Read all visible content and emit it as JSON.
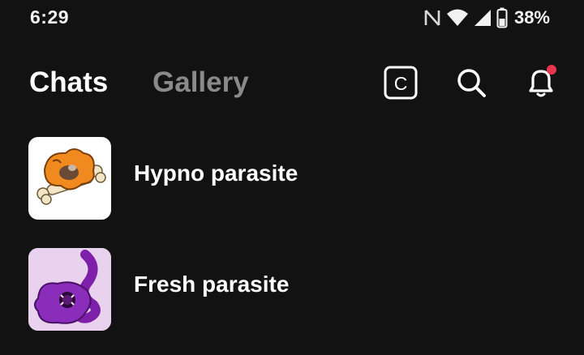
{
  "status_bar": {
    "time": "6:29",
    "battery_percent": "38%",
    "icons": [
      "nfc-icon",
      "wifi-icon",
      "signal-icon",
      "battery-icon"
    ]
  },
  "header": {
    "tabs": [
      {
        "label": "Chats",
        "active": true
      },
      {
        "label": "Gallery",
        "active": false
      }
    ],
    "create_icon_letter": "C",
    "notification_dot_color": "#e8344e"
  },
  "chats": [
    {
      "name": "Hypno parasite",
      "avatar": "orange-creature-avatar"
    },
    {
      "name": "Fresh parasite",
      "avatar": "purple-creature-avatar"
    }
  ],
  "colors": {
    "background": "#121212",
    "text_primary": "#ffffff",
    "text_inactive": "#8a8a8a"
  }
}
